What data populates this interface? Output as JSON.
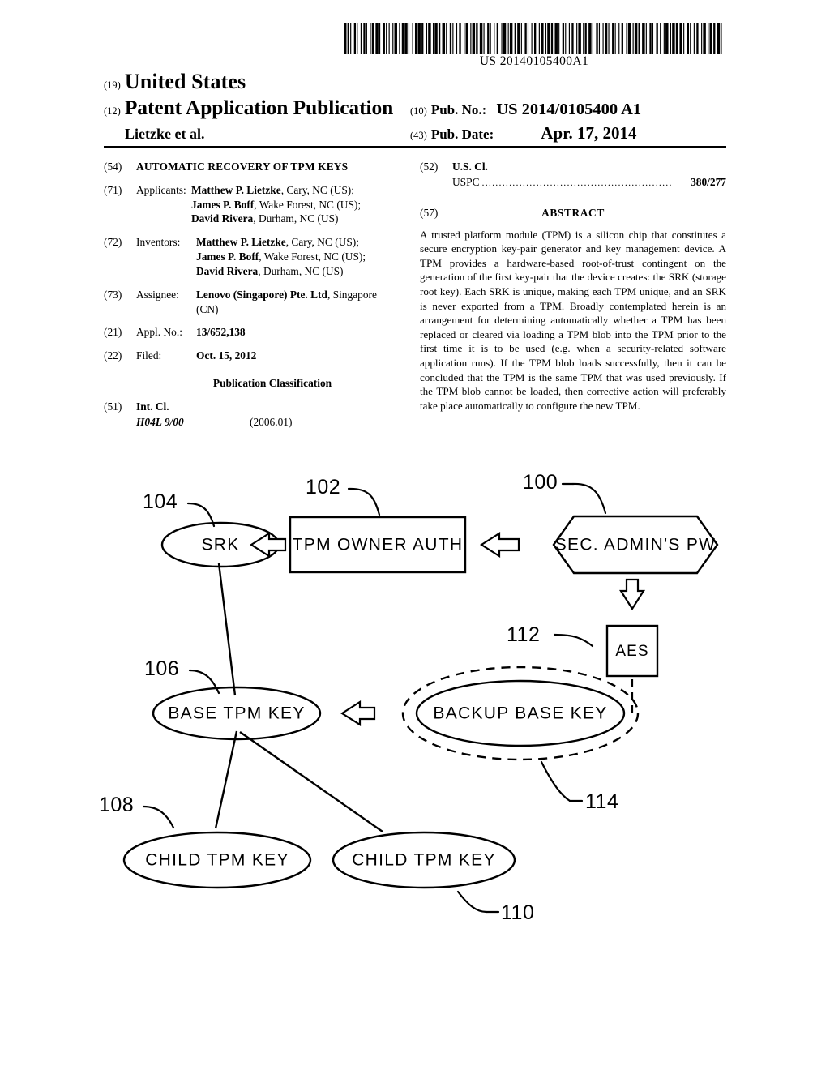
{
  "barcode": {
    "number": "US 20140105400A1",
    "pattern": "3121132113122113112231132112131132122131131221312311321131223113211312231132113122311321131223113211322131132113122311321131223113211312231132112231132113122113211312231132113122311321132213113211312231132113122311321131223113"
  },
  "masthead": {
    "country_code": "(19)",
    "country_name": "United States",
    "doctype_code": "(12)",
    "doctype_name": "Patent Application Publication",
    "author": "Lietzke et al.",
    "pubno_code": "(10)",
    "pubno_label": "Pub. No.:",
    "pubno_value": "US 2014/0105400 A1",
    "pubdate_code": "(43)",
    "pubdate_label": "Pub. Date:",
    "pubdate_value": "Apr. 17, 2014"
  },
  "left_column": {
    "title_code": "(54)",
    "title": "AUTOMATIC RECOVERY OF TPM KEYS",
    "applicants_code": "(71)",
    "applicants_label": "Applicants:",
    "applicants": [
      {
        "name": "Matthew P. Lietzke",
        "rest": ", Cary, NC (US);"
      },
      {
        "name": "James P. Boff",
        "rest": ", Wake Forest, NC (US);"
      },
      {
        "name": "David Rivera",
        "rest": ", Durham, NC (US)"
      }
    ],
    "inventors_code": "(72)",
    "inventors_label": "Inventors:",
    "inventors": [
      {
        "name": "Matthew P. Lietzke",
        "rest": ", Cary, NC (US);"
      },
      {
        "name": "James P. Boff",
        "rest": ", Wake Forest, NC (US);"
      },
      {
        "name": "David Rivera",
        "rest": ", Durham, NC (US)"
      }
    ],
    "assignee_code": "(73)",
    "assignee_label": "Assignee:",
    "assignee_name": "Lenovo (Singapore) Pte. Ltd",
    "assignee_rest": ", Singapore",
    "assignee_line2": "(CN)",
    "applno_code": "(21)",
    "applno_label": "Appl. No.:",
    "applno_value": "13/652,138",
    "filed_code": "(22)",
    "filed_label": "Filed:",
    "filed_value": "Oct. 15, 2012",
    "pubclass_heading": "Publication Classification",
    "intcl_code": "(51)",
    "intcl_label": "Int. Cl.",
    "intcl_class": "H04L 9/00",
    "intcl_version": "(2006.01)"
  },
  "right_column": {
    "uscl_code": "(52)",
    "uscl_label": "U.S. Cl.",
    "uspc_label": "USPC",
    "uspc_dots": "........................................................",
    "uspc_value": "380/277",
    "abstract_code": "(57)",
    "abstract_heading": "ABSTRACT",
    "abstract_text": "A trusted platform module (TPM) is a silicon chip that constitutes a secure encryption key-pair generator and key management device. A TPM provides a hardware-based root-of-trust contingent on the generation of the first key-pair that the device creates: the SRK (storage root key). Each SRK is unique, making each TPM unique, and an SRK is never exported from a TPM. Broadly contemplated herein is an arrangement for determining automatically whether a TPM has been replaced or cleared via loading a TPM blob into the TPM prior to the first time it is to be used (e.g. when a security-related software application runs). If the TPM blob loads successfully, then it can be concluded that the TPM is the same TPM that was used previously. If the TPM blob cannot be loaded, then corrective action will preferably take place automatically to configure the new TPM."
  },
  "figure": {
    "nodes": {
      "srk": "SRK",
      "tpm_owner_auth": "TPM OWNER AUTH",
      "sec_admins_pw": "SEC. ADMIN'S PW",
      "aes": "AES",
      "base_tpm_key": "BASE TPM KEY",
      "backup_base_key": "BACKUP BASE KEY",
      "child_tpm_key_left": "CHILD TPM KEY",
      "child_tpm_key_right": "CHILD TPM KEY"
    },
    "reference_numerals": {
      "sec_admins_pw": "100",
      "tpm_owner_auth": "102",
      "srk": "104",
      "base_tpm_key": "106",
      "child_tpm_key_left": "108",
      "child_tpm_key_right": "110",
      "aes": "112",
      "backup_base_key": "114"
    }
  }
}
